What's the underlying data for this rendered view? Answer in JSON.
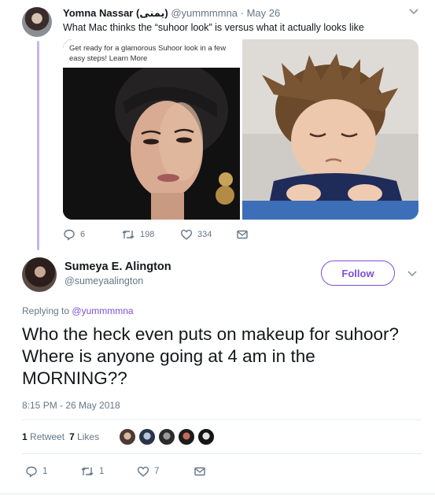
{
  "parent_tweet": {
    "name": "Yomna Nassar (يمنى)",
    "handle": "@yummmmna",
    "date": "· May 26",
    "text": "What Mac thinks the “suhoor look” is versus what it actually looks like",
    "media": {
      "ad_text": "Get ready for a glamorous Suhoor look in a few easy steps! Learn More"
    },
    "replies": "6",
    "retweets": "198",
    "likes": "334"
  },
  "main_tweet": {
    "name": "Sumeya E. Alington",
    "handle": "@sumeyaalington",
    "follow_label": "Follow",
    "replying_prefix": "Replying to",
    "replying_to": "@yummmmna",
    "text": "Who the heck even puts on makeup for suhoor? Where is anyone going at 4 am in the MORNING??",
    "timestamp": "8:15 PM - 26 May 2018",
    "retweet_count": "1",
    "retweet_label": "Retweet",
    "like_count": "7",
    "like_label": "Likes",
    "replies": "1",
    "retweets": "1",
    "likes": "7"
  },
  "colors": {
    "accent": "#7d4fd6",
    "thread_line": "#c8b3ea",
    "muted": "#657786",
    "text": "#14171a"
  },
  "icons": [
    "reply-icon",
    "retweet-icon",
    "like-icon",
    "message-icon",
    "chevron-down-icon"
  ]
}
